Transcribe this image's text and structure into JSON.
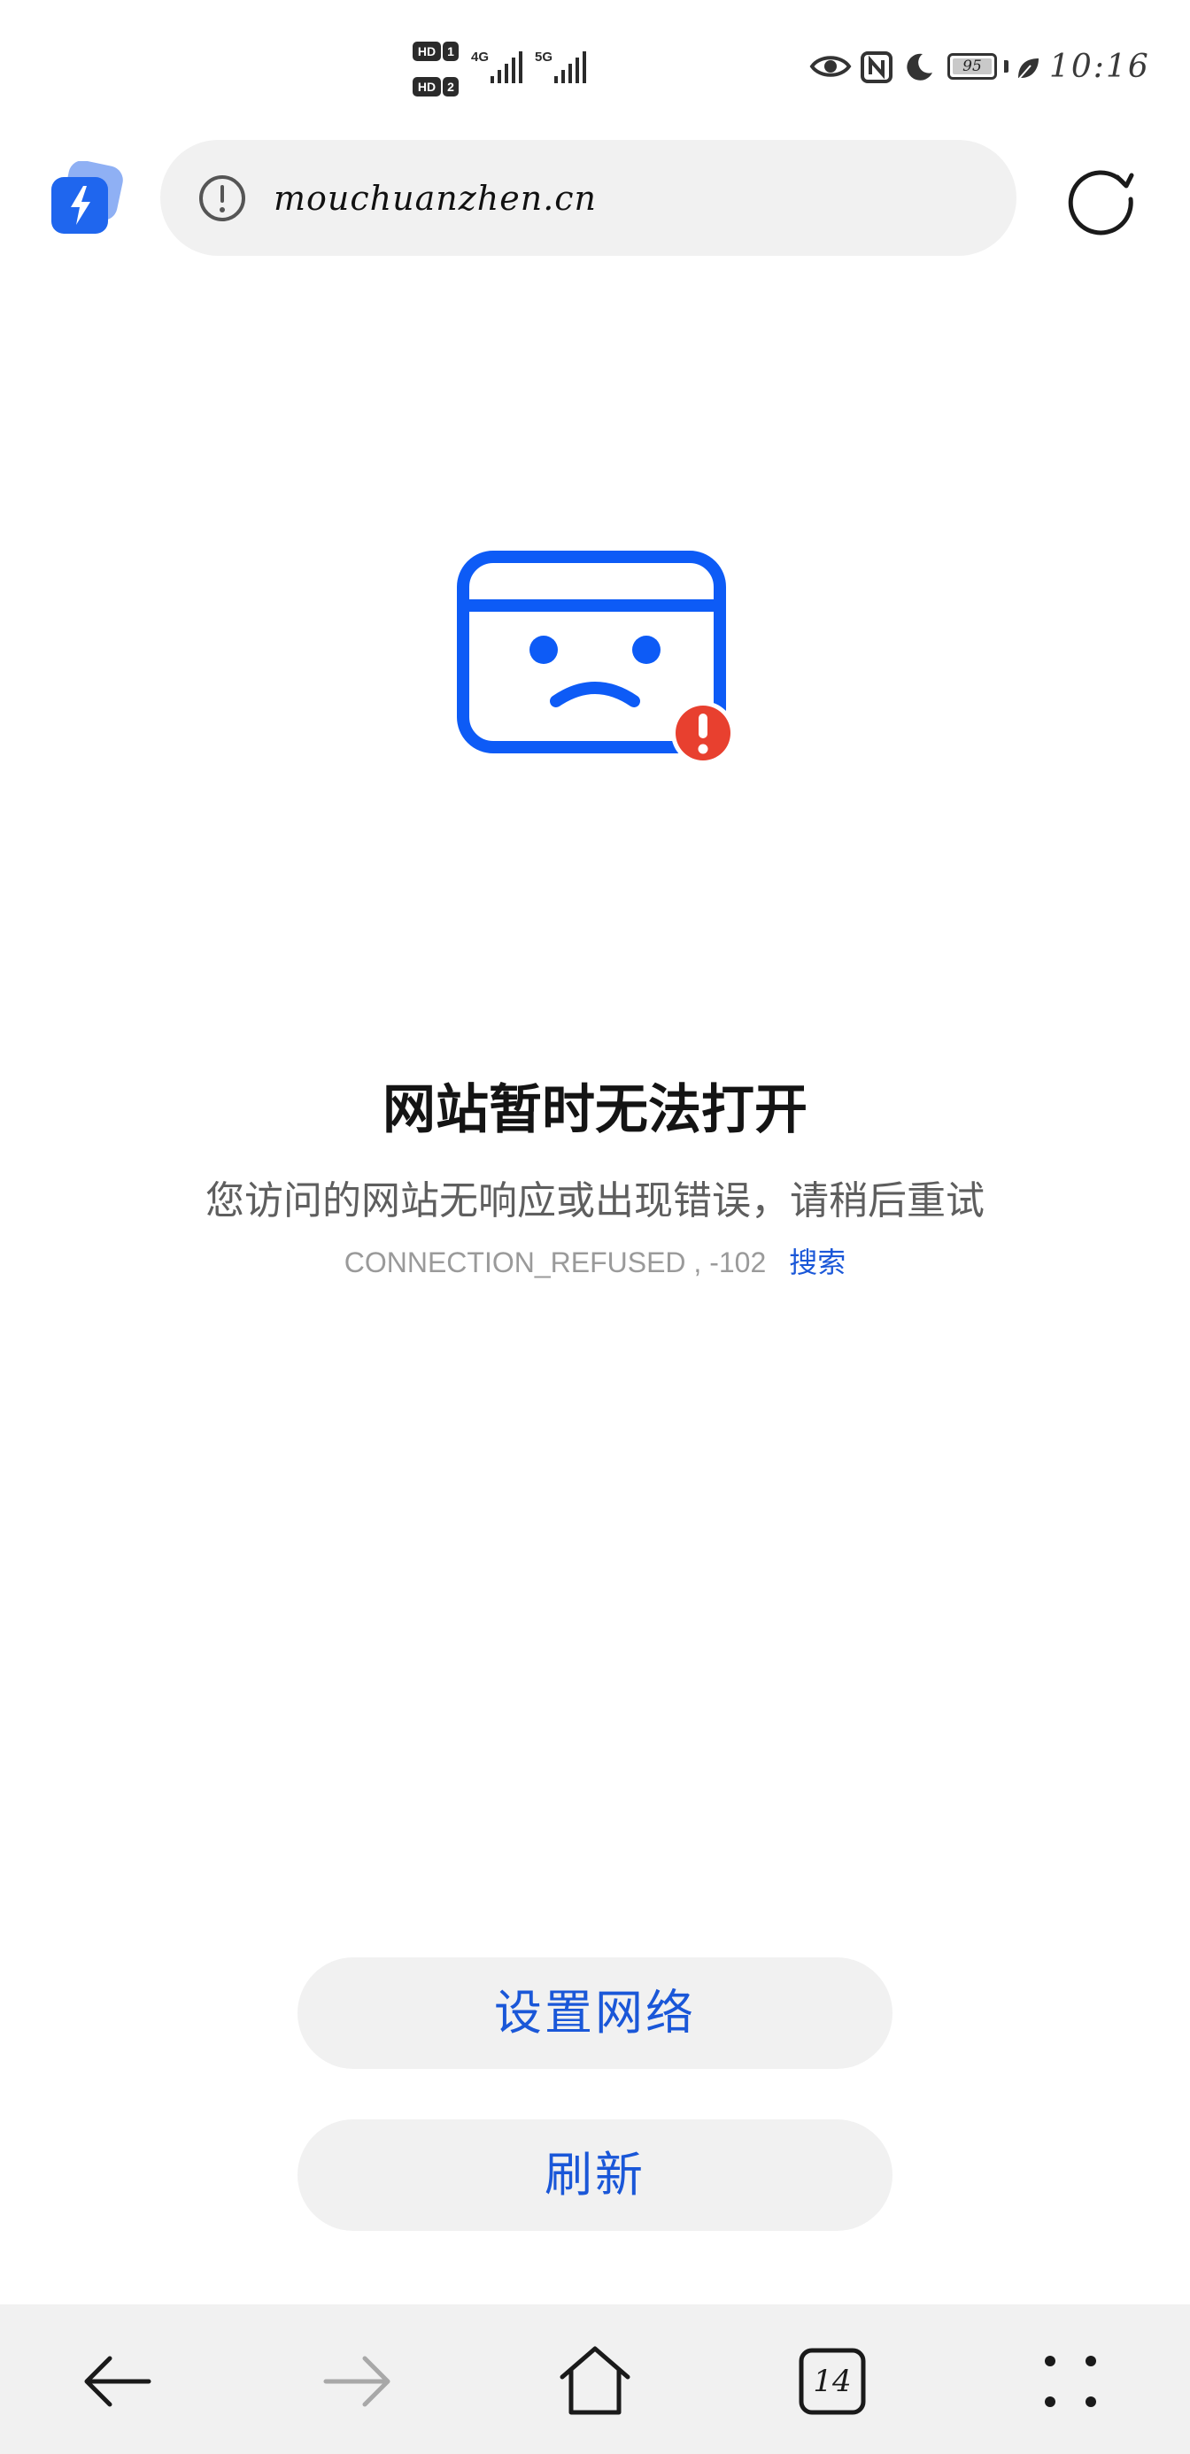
{
  "status_bar": {
    "sim1_label": "HD",
    "sim1_num": "1",
    "sim2_label": "HD",
    "sim2_num": "2",
    "net1": "4G",
    "net2": "5G",
    "battery_level": "95",
    "time": "10:16",
    "icons": [
      "eye-comfort-icon",
      "nfc-icon",
      "do-not-disturb-icon",
      "battery-icon",
      "leaf-icon"
    ]
  },
  "address_bar": {
    "url": "mouchuanzhen.cn",
    "icons": [
      "app-bolt-icon",
      "site-info-icon",
      "reload-icon"
    ]
  },
  "error": {
    "title": "网站暂时无法打开",
    "description": "您访问的网站无响应或出现错误，请稍后重试",
    "code": "CONNECTION_REFUSED , -102",
    "search_link": "搜索",
    "illustration_icon": "sad-page-icon",
    "colors": {
      "illustration": "#0d5bf6",
      "alert_badge": "#e8402f",
      "link": "#1a57d8"
    }
  },
  "buttons": {
    "network_settings": "设置网络",
    "refresh": "刷新"
  },
  "toolbar": {
    "tab_count": "14",
    "icons": [
      "back-arrow-icon",
      "forward-arrow-icon",
      "home-icon",
      "tabs-icon",
      "more-dots-icon"
    ]
  }
}
